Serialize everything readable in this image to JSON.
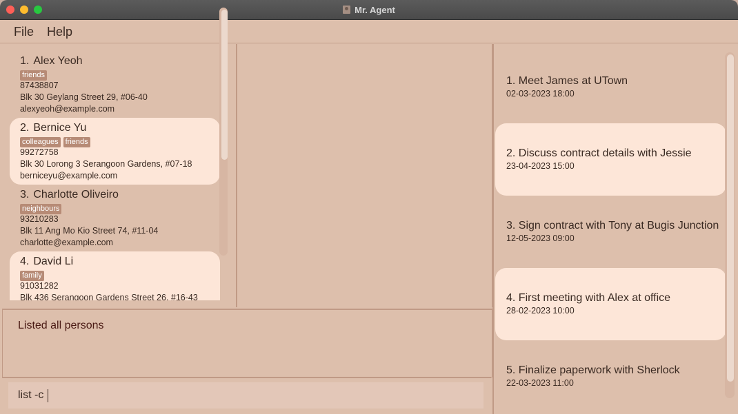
{
  "window": {
    "title": "Mr. Agent"
  },
  "menu": {
    "file": "File",
    "help": "Help"
  },
  "persons": [
    {
      "index": "1.",
      "name": "Alex Yeoh",
      "tags": [
        "friends"
      ],
      "phone": "87438807",
      "address": "Blk 30 Geylang Street 29, #06-40",
      "email": "alexyeoh@example.com",
      "highlighted": false
    },
    {
      "index": "2.",
      "name": "Bernice Yu",
      "tags": [
        "colleagues",
        "friends"
      ],
      "phone": "99272758",
      "address": "Blk 30 Lorong 3 Serangoon Gardens, #07-18",
      "email": "berniceyu@example.com",
      "highlighted": true
    },
    {
      "index": "3.",
      "name": "Charlotte Oliveiro",
      "tags": [
        "neighbours"
      ],
      "phone": "93210283",
      "address": "Blk 11 Ang Mo Kio Street 74, #11-04",
      "email": "charlotte@example.com",
      "highlighted": false
    },
    {
      "index": "4.",
      "name": "David Li",
      "tags": [
        "family"
      ],
      "phone": "91031282",
      "address": "Blk 436 Serangoon Gardens Street 26, #16-43",
      "email": "",
      "highlighted": true
    }
  ],
  "result": {
    "text": "Listed all persons"
  },
  "command": {
    "value": "list -c"
  },
  "meetings": [
    {
      "title": "1. Meet James at UTown",
      "time": "02-03-2023 18:00",
      "highlighted": false
    },
    {
      "title": "2. Discuss contract details with Jessie",
      "time": "23-04-2023 15:00",
      "highlighted": true
    },
    {
      "title": "3. Sign contract with Tony at Bugis Junction",
      "time": "12-05-2023 09:00",
      "highlighted": false
    },
    {
      "title": "4. First meeting with Alex at office",
      "time": "28-02-2023 10:00",
      "highlighted": true
    },
    {
      "title": "5. Finalize paperwork with Sherlock",
      "time": "22-03-2023 11:00",
      "highlighted": false
    }
  ],
  "colors": {
    "card_highlight": "#fde6d8",
    "background": "#ddbfac",
    "tag": "#b78b76",
    "result_text": "#4a1a14"
  }
}
